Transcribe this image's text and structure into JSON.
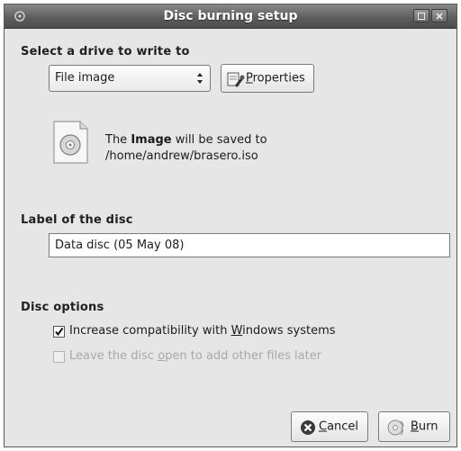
{
  "window": {
    "title": "Disc burning setup"
  },
  "drive_section": {
    "heading": "Select a drive to write to",
    "selected_drive": "File image",
    "properties_button": {
      "prefix": "",
      "accel": "P",
      "rest": "roperties"
    }
  },
  "info": {
    "line1_prefix": "The ",
    "line1_bold": "Image",
    "line1_suffix": " will be saved to",
    "line2": "/home/andrew/brasero.iso"
  },
  "label_section": {
    "heading": "Label of the disc",
    "value": "Data disc (05 May 08)"
  },
  "options_section": {
    "heading": "Disc options",
    "option1": {
      "prefix": "Increase compatibility with ",
      "accel": "W",
      "rest": "indows systems",
      "checked": true,
      "enabled": true
    },
    "option2": {
      "prefix": "Leave the disc ",
      "accel": "o",
      "rest": "pen to add other files later",
      "checked": false,
      "enabled": false
    }
  },
  "buttons": {
    "cancel": {
      "prefix": "",
      "accel": "C",
      "rest": "ancel"
    },
    "burn": {
      "prefix": "",
      "accel": "B",
      "rest": "urn"
    }
  },
  "icons": {
    "window_menu": "window-menu-icon",
    "minimize": "minimize-icon",
    "close": "close-icon",
    "properties": "properties-icon",
    "disc_image": "disc-image-icon",
    "cancel": "cancel-icon",
    "burn": "burn-icon"
  },
  "colors": {
    "window_bg": "#e6e6e6",
    "titlebar": "#5e5e5e"
  }
}
